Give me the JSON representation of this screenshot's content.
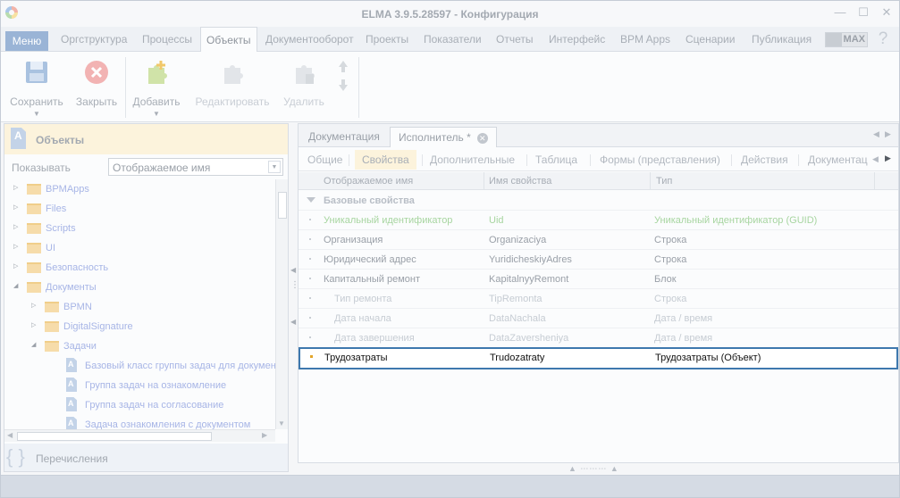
{
  "app": {
    "title": "ELMA 3.9.5.28597 - Конфигурация",
    "window_buttons": [
      "—",
      "☐",
      "✕"
    ]
  },
  "menu": {
    "main": "Меню",
    "items": [
      "Оргструктура",
      "Процессы",
      "Объекты",
      "Документооборот",
      "Проекты",
      "Показатели",
      "Отчеты",
      "Интерфейс",
      "BPM Apps",
      "Сценарии",
      "Публикация"
    ],
    "active": "Объекты",
    "max_label": "MAX",
    "help_glyph": "?"
  },
  "ribbon": {
    "save": "Сохранить",
    "close": "Закрыть",
    "add": "Добавить",
    "edit": "Редактировать",
    "delete": "Удалить"
  },
  "left_panel": {
    "title": "Объекты",
    "title_icon_letter": "A",
    "show_label": "Показывать",
    "show_value": "Отображаемое имя",
    "tree": [
      "BPMApps",
      "Files",
      "Scripts",
      "UI",
      "Безопасность",
      "Документы",
      "BPMN",
      "DigitalSignature",
      "Задачи",
      "Базовый класс группы задач для документ",
      "Группа задач на ознакомление",
      "Группа задач на согласование",
      "Задача ознакомления с документом"
    ],
    "enum_label": "Перечисления",
    "enum_glyph": "{ }"
  },
  "doc_tabs": {
    "tab1": "Документация",
    "tab2": "Исполнитель *",
    "close_glyph": "✕"
  },
  "sub_tabs": [
    "Общие",
    "Свойства",
    "Дополнительные",
    "Таблица",
    "Формы (представления)",
    "Действия",
    "Документац"
  ],
  "active_sub_tab": "Свойства",
  "grid": {
    "headers": [
      "Отображаемое имя",
      "Имя свойства",
      "Тип"
    ],
    "group": "Базовые свойства",
    "rows": [
      {
        "name": "Уникальный идентификатор",
        "prop": "Uid",
        "type": "Уникальный идентификатор (GUID)"
      },
      {
        "name": "Организация",
        "prop": "Organizaciya",
        "type": "Строка"
      },
      {
        "name": "Юридический адрес",
        "prop": "YuridicheskiyAdres",
        "type": "Строка"
      },
      {
        "name": "Капитальный ремонт",
        "prop": "KapitalnyyRemont",
        "type": "Блок"
      },
      {
        "name": "Тип ремонта",
        "prop": "TipRemonta",
        "type": "Строка"
      },
      {
        "name": "Дата начала",
        "prop": "DataNachala",
        "type": "Дата / время"
      },
      {
        "name": "Дата завершения",
        "prop": "DataZaversheniya",
        "type": "Дата / время"
      },
      {
        "name": "Трудозатраты",
        "prop": "Trudozatraty",
        "type": "Трудозатраты (Объект)"
      }
    ]
  }
}
